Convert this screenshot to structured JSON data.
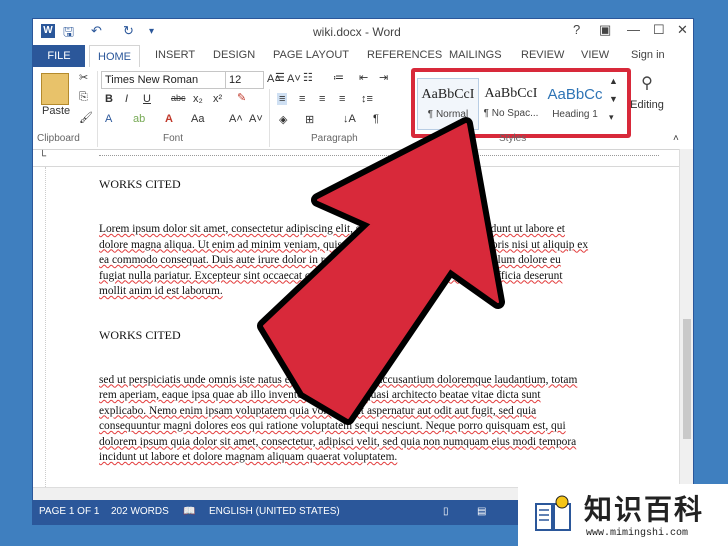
{
  "window": {
    "title": "wiki.docx - Word",
    "help": "?",
    "signin": "Sign in"
  },
  "tabs": [
    "FILE",
    "HOME",
    "INSERT",
    "DESIGN",
    "PAGE LAYOUT",
    "REFERENCES",
    "MAILINGS",
    "REVIEW",
    "VIEW"
  ],
  "ribbon": {
    "paste_label": "Paste",
    "clipboard_label": "Clipboard",
    "font_name": "Times New Roman",
    "font_size": "12",
    "font_label": "Font",
    "paragraph_label": "Paragraph",
    "styles_label": "Styles",
    "editing_label": "Editing",
    "styles": [
      {
        "sample": "AaBbCcI",
        "name": "¶ Normal"
      },
      {
        "sample": "AaBbCcI",
        "name": "¶ No Spac..."
      },
      {
        "sample": "AaBbCc",
        "name": "Heading 1"
      }
    ]
  },
  "document": {
    "heading1": "WORKS CITED",
    "para1": "Lorem ipsum dolor sit amet, consectetur adipiscing elit, sed do eiusmod tempor incididunt ut labore et dolore magna aliqua. Ut enim ad minim veniam, quis nostrud exercitation ullamco laboris nisi ut aliquip ex ea commodo consequat. Duis aute irure dolor in reprehenderit in voluptate velit esse cillum dolore eu fugiat nulla pariatur. Excepteur sint occaecat cupidatat non proident, sunt in culpa qui officia deserunt mollit anim id est laborum.",
    "heading2": "WORKS CITED",
    "para2": "sed ut perspiciatis unde omnis iste natus error sit voluptatem accusantium doloremque laudantium, totam rem aperiam, eaque ipsa quae ab illo inventore veritatis et quasi architecto beatae vitae dicta sunt explicabo. Nemo enim ipsam voluptatem quia voluptas sit aspernatur aut odit aut fugit, sed quia consequuntur magni dolores eos qui ratione voluptatem sequi nesciunt. Neque porro quisquam est, qui dolorem ipsum quia dolor sit amet, consectetur, adipisci velit, sed quia non numquam eius modi tempora incidunt ut labore et dolore magnam aliquam quaerat voluptatem."
  },
  "status": {
    "page": "PAGE 1 OF 1",
    "words": "202 WORDS",
    "language": "ENGLISH (UNITED STATES)"
  },
  "watermark": {
    "text": "知识百科",
    "url": "www.mimingshi.com"
  },
  "colors": {
    "word_blue": "#2b579a",
    "arrow_red": "#d8293a",
    "highlight_red": "#d8293a"
  }
}
